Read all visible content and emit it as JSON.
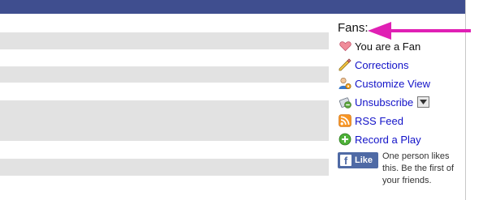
{
  "fans_panel": {
    "title": "Fans:",
    "status": {
      "label": "You are a Fan",
      "icon": "heart-icon"
    },
    "actions": [
      {
        "label": "Corrections",
        "icon": "pencil-icon"
      },
      {
        "label": "Customize View",
        "icon": "user-settings-icon"
      },
      {
        "label": "Unsubscribe",
        "icon": "unsubscribe-icon"
      },
      {
        "label": "RSS Feed",
        "icon": "rss-icon"
      },
      {
        "label": "Record a Play",
        "icon": "add-icon"
      }
    ],
    "like_button": {
      "label": "Like",
      "logo": "f"
    },
    "like_text": "One person likes this. Be the first of your friends."
  },
  "colors": {
    "header": "#3f4e8f",
    "placeholder_bar": "#e2e2e2",
    "link": "#1212c8",
    "arrow": "#e020b4",
    "facebook": "#4f6aa5"
  }
}
